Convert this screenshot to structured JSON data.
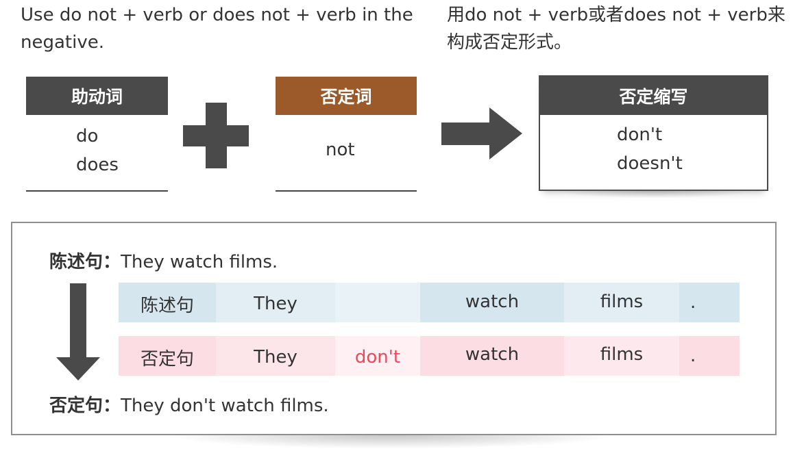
{
  "intro": {
    "english": "Use do not + verb or does not + verb in the negative.",
    "chinese": "用do not + verb或者does not + verb来构成否定形式。"
  },
  "formula": {
    "auxiliary": {
      "header": "助动词",
      "items": [
        "do",
        "does"
      ]
    },
    "negation": {
      "header": "否定词",
      "items": [
        "not"
      ]
    },
    "contraction": {
      "header": "否定缩写",
      "items": [
        "don't",
        "doesn't"
      ]
    }
  },
  "example": {
    "affirmative_label": "陈述句：",
    "affirmative_sentence": "They watch films.",
    "negative_label": "否定句：",
    "negative_sentence": "They don't watch films.",
    "affirmative_row": [
      "陈述句",
      "They",
      "",
      "watch",
      "films",
      "."
    ],
    "negative_row": [
      "否定句",
      "They",
      "don't",
      "watch",
      "films",
      "."
    ]
  },
  "colors": {
    "dark_header": "#4a4a4a",
    "brown_header": "#9c5a2a",
    "affirmative_row": "#d5e6ee",
    "negative_row": "#fcdde3",
    "negation_highlight": "#e84a5b"
  },
  "icons": [
    "plus-icon",
    "arrow-right-icon",
    "arrow-down-icon"
  ]
}
